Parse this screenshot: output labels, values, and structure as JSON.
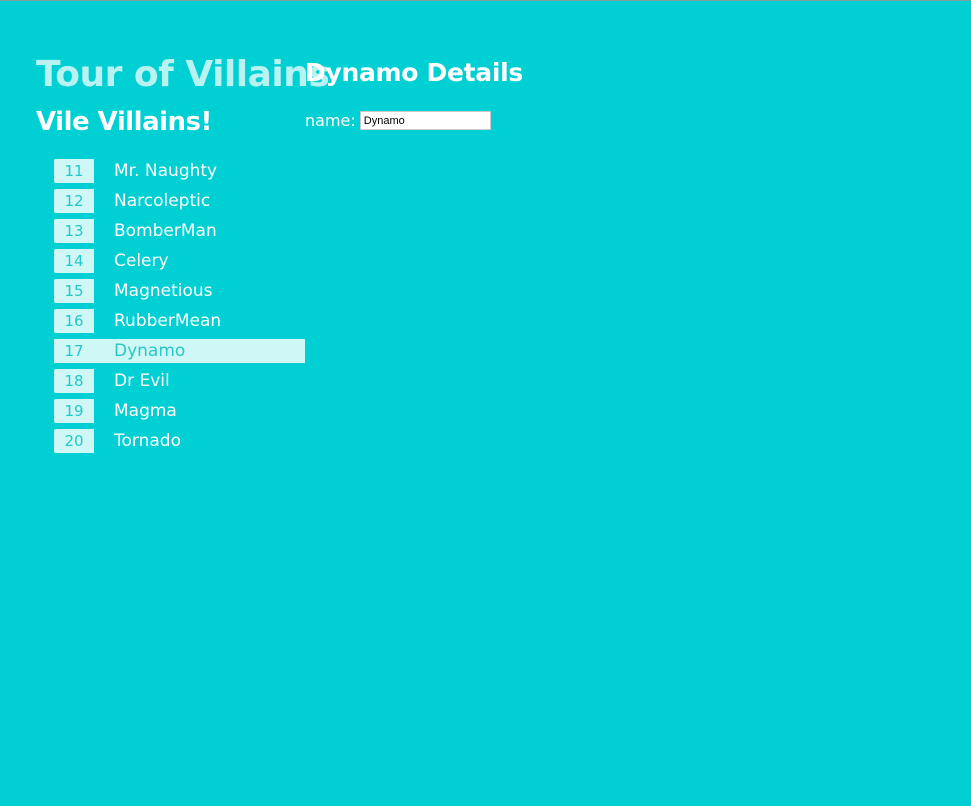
{
  "app": {
    "title": "Tour of Villains"
  },
  "list": {
    "title": "Vile Villains!",
    "items": [
      {
        "id": "11",
        "name": "Mr. Naughty"
      },
      {
        "id": "12",
        "name": "Narcoleptic"
      },
      {
        "id": "13",
        "name": "BomberMan"
      },
      {
        "id": "14",
        "name": "Celery"
      },
      {
        "id": "15",
        "name": "Magnetious"
      },
      {
        "id": "16",
        "name": "RubberMean"
      },
      {
        "id": "17",
        "name": "Dynamo"
      },
      {
        "id": "18",
        "name": "Dr Evil"
      },
      {
        "id": "19",
        "name": "Magma"
      },
      {
        "id": "20",
        "name": "Tornado"
      }
    ],
    "selected_index": 6
  },
  "details": {
    "title": "Dynamo Details",
    "name_label": "name:",
    "name_value": "Dynamo"
  },
  "colors": {
    "background": "#00cfd3",
    "title_accent": "#b9f3f1",
    "badge_background": "#cff7f5",
    "badge_text": "#22c9c9",
    "text": "#ffffff"
  }
}
